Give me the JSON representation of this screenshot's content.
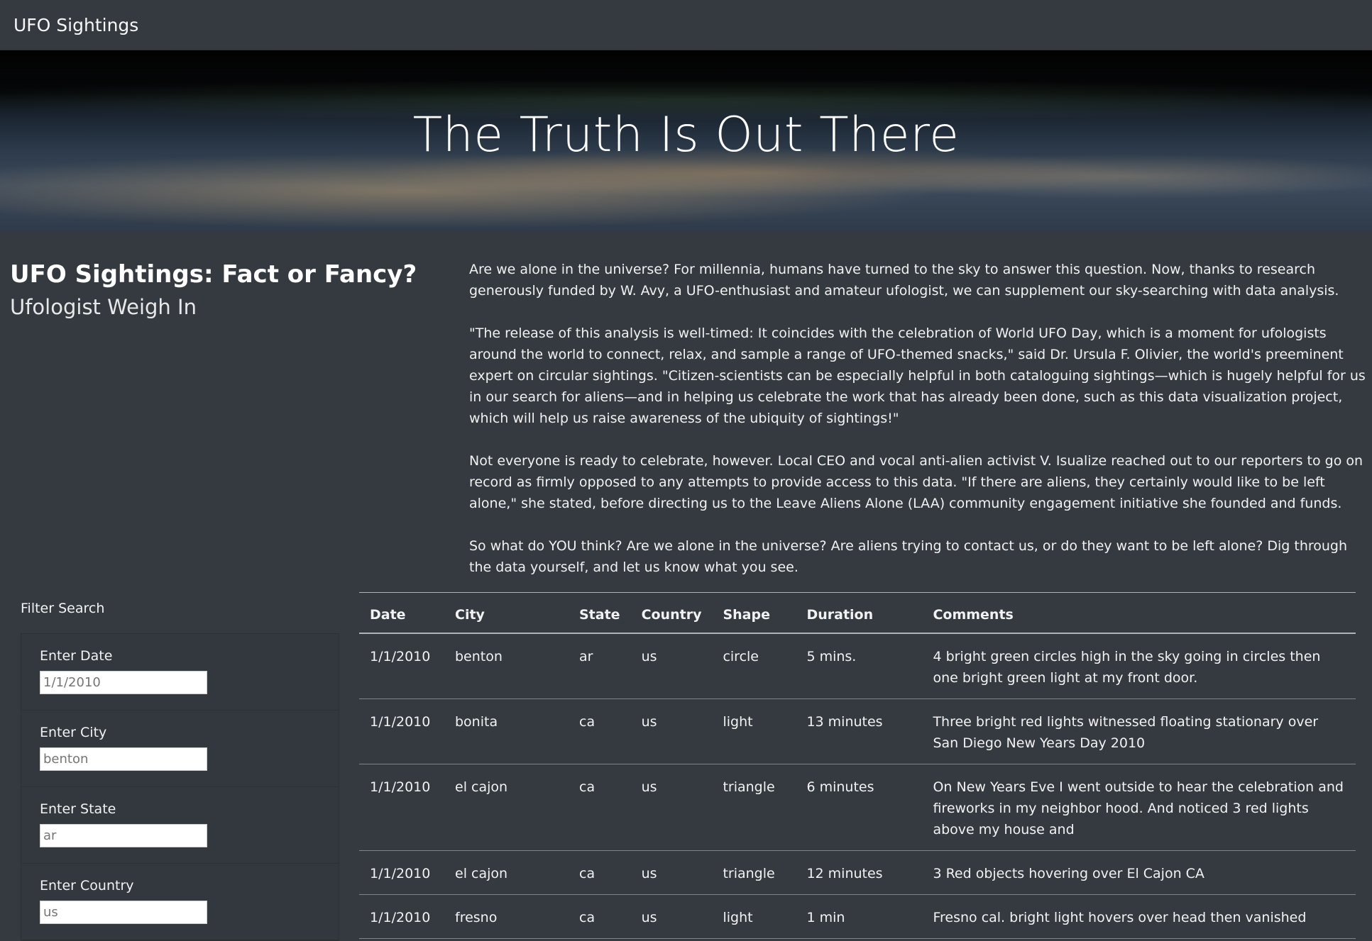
{
  "navbar": {
    "brand": "UFO Sightings"
  },
  "hero": {
    "title": "The Truth Is Out There"
  },
  "intro": {
    "heading": "UFO Sightings: Fact or Fancy?",
    "heading_small": "Ufologist Weigh In",
    "paragraphs": [
      "Are we alone in the universe? For millennia, humans have turned to the sky to answer this question. Now, thanks to research generously funded by W. Avy, a UFO-enthusiast and amateur ufologist, we can supplement our sky-searching with data analysis.",
      "\"The release of this analysis is well-timed: It coincides with the celebration of World UFO Day, which is a moment for ufologists around the world to connect, relax, and sample a range of UFO-themed snacks,\" said Dr. Ursula F. Olivier, the world's preeminent expert on circular sightings. \"Citizen-scientists can be especially helpful in both cataloguing sightings—which is hugely helpful for us in our search for aliens—and in helping us celebrate the work that has already been done, such as this data visualization project, which will help us raise awareness of the ubiquity of sightings!\"",
      "Not everyone is ready to celebrate, however. Local CEO and vocal anti-alien activist V. Isualize reached out to our reporters to go on record as firmly opposed to any attempts to provide access to this data. \"If there are aliens, they certainly would like to be left alone,\" she stated, before directing us to the Leave Aliens Alone (LAA) community engagement initiative she founded and funds.",
      "So what do YOU think? Are we alone in the universe? Are aliens trying to contact us, or do they want to be left alone? Dig through the data yourself, and let us know what you see."
    ]
  },
  "filters": {
    "title": "Filter Search",
    "items": [
      {
        "label": "Enter Date",
        "placeholder": "1/1/2010"
      },
      {
        "label": "Enter City",
        "placeholder": "benton"
      },
      {
        "label": "Enter State",
        "placeholder": "ar"
      },
      {
        "label": "Enter Country",
        "placeholder": "us"
      }
    ]
  },
  "table": {
    "headers": [
      "Date",
      "City",
      "State",
      "Country",
      "Shape",
      "Duration",
      "Comments"
    ],
    "rows": [
      [
        "1/1/2010",
        "benton",
        "ar",
        "us",
        "circle",
        "5 mins.",
        "4 bright green circles high in the sky going in circles then one bright green light at my front door."
      ],
      [
        "1/1/2010",
        "bonita",
        "ca",
        "us",
        "light",
        "13 minutes",
        "Three bright red lights witnessed floating stationary over San Diego New Years Day 2010"
      ],
      [
        "1/1/2010",
        "el cajon",
        "ca",
        "us",
        "triangle",
        "6 minutes",
        "On New Years Eve I went outside to hear the celebration and fireworks in my neighbor hood. And noticed 3 red lights above my house and"
      ],
      [
        "1/1/2010",
        "el cajon",
        "ca",
        "us",
        "triangle",
        "12 minutes",
        "3 Red objects hovering over El Cajon CA"
      ],
      [
        "1/1/2010",
        "fresno",
        "ca",
        "us",
        "light",
        "1 min",
        "Fresno cal. bright light hovers over head then vanished"
      ]
    ]
  }
}
